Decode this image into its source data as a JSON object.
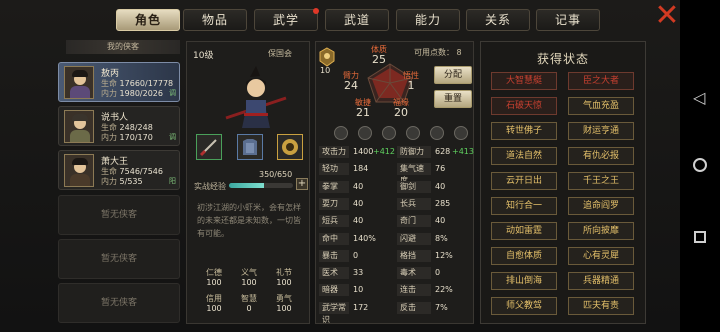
{
  "tabs": [
    {
      "label": "角色",
      "active": true
    },
    {
      "label": "物品"
    },
    {
      "label": "武学",
      "dot": true
    },
    {
      "label": "武道"
    },
    {
      "label": "能力"
    },
    {
      "label": "关系"
    },
    {
      "label": "记事"
    }
  ],
  "list_title": "我的侠客",
  "characters": [
    {
      "name": "敖丙",
      "hp_label": "生命",
      "hp": "17660/17778",
      "mp_label": "内力",
      "mp": "1980/2026",
      "badge": "调"
    },
    {
      "name": "说书人",
      "hp_label": "生命",
      "hp": "248/248",
      "mp_label": "内力",
      "mp": "170/170",
      "badge": "调"
    },
    {
      "name": "萧大王",
      "hp_label": "生命",
      "hp": "7546/7546",
      "mp_label": "内力",
      "mp": "5/535",
      "badge": "阳"
    }
  ],
  "empty_slot": "暂无侠客",
  "profile": {
    "level": "10级",
    "sect": "保国会",
    "badge_level": "10",
    "exp_label": "实战经验",
    "exp_text": "350/650",
    "exp_fraction": 0.54,
    "description": "初涉江湖的小虾米，会有怎样的未来还都是未知数，一切皆有可能。"
  },
  "virtues": [
    {
      "k": "仁德",
      "v": "100"
    },
    {
      "k": "义气",
      "v": "100"
    },
    {
      "k": "礼节",
      "v": "100"
    },
    {
      "k": "信用",
      "v": "100"
    },
    {
      "k": "智慧",
      "v": "0"
    },
    {
      "k": "勇气",
      "v": "100"
    }
  ],
  "points_label": "可用点数：",
  "points": "8",
  "attributes": [
    {
      "k": "体质",
      "v": "25"
    },
    {
      "k": "臂力",
      "v": "24"
    },
    {
      "k": "悟性",
      "v": "1"
    },
    {
      "k": "敏捷",
      "v": "21"
    },
    {
      "k": "福缘",
      "v": "20"
    }
  ],
  "btn_allocate": "分配",
  "btn_reset": "重置",
  "stats": [
    {
      "k": "攻击力",
      "v": "1400",
      "b": "+412",
      "k2": "防御力",
      "v2": "628",
      "b2": "+413"
    },
    {
      "k": "轻功",
      "v": "184",
      "k2": "集气速度",
      "v2": "76"
    },
    {
      "k": "拳掌",
      "v": "40",
      "k2": "御剑",
      "v2": "40"
    },
    {
      "k": "耍刀",
      "v": "40",
      "k2": "长兵",
      "v2": "285"
    },
    {
      "k": "短兵",
      "v": "40",
      "k2": "奇门",
      "v2": "40"
    },
    {
      "k": "命中",
      "v": "140%",
      "k2": "闪避",
      "v2": "8%"
    },
    {
      "k": "暴击",
      "v": "0",
      "k2": "格挡",
      "v2": "12%"
    },
    {
      "k": "医术",
      "v": "33",
      "k2": "毒术",
      "v2": "0"
    },
    {
      "k": "暗器",
      "v": "10",
      "k2": "连击",
      "v2": "22%"
    },
    {
      "k": "武学常识",
      "v": "172",
      "k2": "反击",
      "v2": "7%"
    }
  ],
  "status_title": "获得状态",
  "statuses": [
    {
      "label": "大智慧艇",
      "red": true
    },
    {
      "label": "臣之大者",
      "red": true
    },
    {
      "label": "石破天惊",
      "red": true
    },
    {
      "label": "气血充盈"
    },
    {
      "label": "转世佛子"
    },
    {
      "label": "财运亨通"
    },
    {
      "label": "道法自然"
    },
    {
      "label": "有仇必报"
    },
    {
      "label": "云开日出"
    },
    {
      "label": "千王之王"
    },
    {
      "label": "知行合一"
    },
    {
      "label": "追命阎罗"
    },
    {
      "label": "动如雷霆"
    },
    {
      "label": "所向披靡"
    },
    {
      "label": "自愈体质"
    },
    {
      "label": "心有灵犀"
    },
    {
      "label": "排山倒海"
    },
    {
      "label": "兵器精通"
    },
    {
      "label": "师父教驾"
    },
    {
      "label": "匹夫有责"
    }
  ],
  "colors": {
    "accent": "#e4c06a",
    "alert": "#c84030",
    "bonus": "#5fd05f"
  },
  "icons": [
    "close-icon",
    "plus-icon",
    "back-icon",
    "home-icon",
    "recents-icon"
  ]
}
